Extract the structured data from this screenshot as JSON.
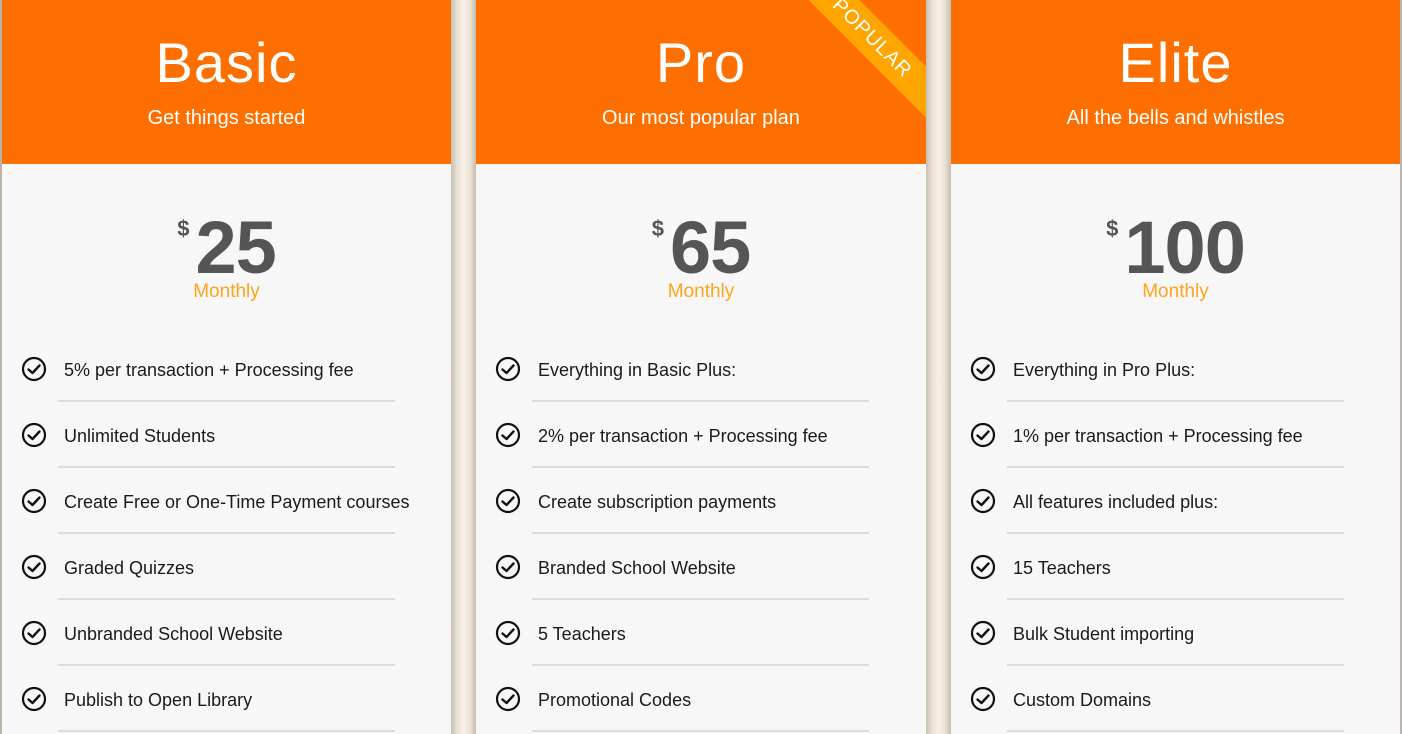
{
  "colors": {
    "header": "#ff6f00",
    "ribbon": "#ffa500",
    "period": "#ffa31a",
    "price": "#555555",
    "body": "#f7f7f7"
  },
  "plans": [
    {
      "name": "Basic",
      "tagline": "Get things started",
      "currency": "$",
      "price": "25",
      "period": "Monthly",
      "features": [
        "5% per transaction + Processing fee",
        "Unlimited Students",
        "Create Free or One-Time Payment courses",
        "Graded Quizzes",
        "Unbranded School Website",
        "Publish to Open Library"
      ]
    },
    {
      "name": "Pro",
      "tagline": "Our most popular plan",
      "badge": "POPULAR",
      "currency": "$",
      "price": "65",
      "period": "Monthly",
      "features": [
        "Everything in Basic Plus:",
        "2% per transaction + Processing fee",
        "Create subscription payments",
        "Branded School Website",
        "5 Teachers",
        "Promotional Codes"
      ]
    },
    {
      "name": "Elite",
      "tagline": "All the bells and whistles",
      "currency": "$",
      "price": "100",
      "period": "Monthly",
      "features": [
        "Everything in Pro Plus:",
        "1% per transaction + Processing fee",
        "All features included plus:",
        "15 Teachers",
        "Bulk Student importing",
        "Custom Domains"
      ]
    }
  ]
}
